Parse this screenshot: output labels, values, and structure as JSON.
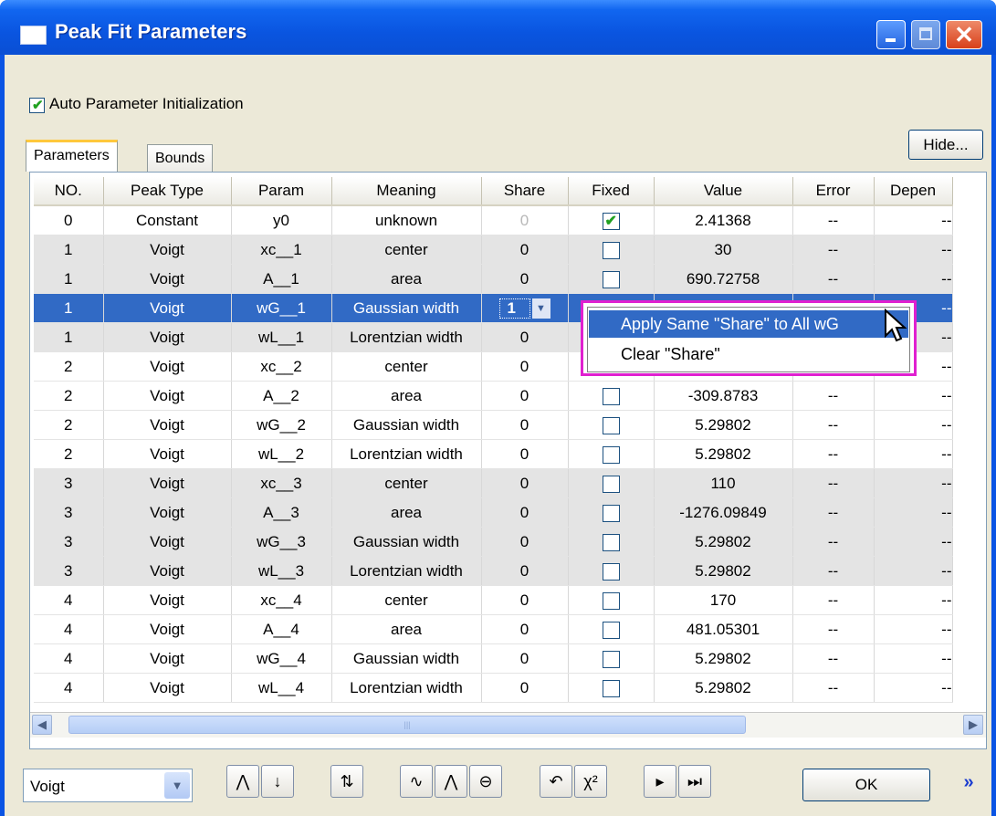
{
  "window": {
    "title": "Peak Fit Parameters",
    "close_glyph": "✕"
  },
  "auto_init": {
    "label": "Auto Parameter Initialization",
    "checked": true
  },
  "tabs": [
    {
      "label": "Parameters",
      "active": true
    },
    {
      "label": "Bounds",
      "active": false
    }
  ],
  "hide_button": "Hide...",
  "columns": [
    "NO.",
    "Peak Type",
    "Param",
    "Meaning",
    "Share",
    "Fixed",
    "Value",
    "Error",
    "Depen"
  ],
  "rows": [
    {
      "no": "0",
      "type": "Constant",
      "param": "y0",
      "meaning": "unknown",
      "share": "0",
      "fixed": true,
      "value": "2.41368",
      "error": "--",
      "dep": "--",
      "style": "w",
      "share_dim": true
    },
    {
      "no": "1",
      "type": "Voigt",
      "param": "xc__1",
      "meaning": "center",
      "share": "0",
      "fixed": false,
      "value": "30",
      "error": "--",
      "dep": "--",
      "style": "g"
    },
    {
      "no": "1",
      "type": "Voigt",
      "param": "A__1",
      "meaning": "area",
      "share": "0",
      "fixed": false,
      "value": "690.72758",
      "error": "--",
      "dep": "--",
      "style": "g"
    },
    {
      "no": "1",
      "type": "Voigt",
      "param": "wG__1",
      "meaning": "Gaussian width",
      "share": "1",
      "fixed": false,
      "value": "",
      "error": "",
      "dep": "--",
      "style": "sel"
    },
    {
      "no": "1",
      "type": "Voigt",
      "param": "wL__1",
      "meaning": "Lorentzian width",
      "share": "0",
      "fixed": false,
      "value": "",
      "error": "",
      "dep": "--",
      "style": "g"
    },
    {
      "no": "2",
      "type": "Voigt",
      "param": "xc__2",
      "meaning": "center",
      "share": "0",
      "fixed": false,
      "value": "",
      "error": "",
      "dep": "--",
      "style": "w"
    },
    {
      "no": "2",
      "type": "Voigt",
      "param": "A__2",
      "meaning": "area",
      "share": "0",
      "fixed": false,
      "value": "-309.8783",
      "error": "--",
      "dep": "--",
      "style": "w"
    },
    {
      "no": "2",
      "type": "Voigt",
      "param": "wG__2",
      "meaning": "Gaussian width",
      "share": "0",
      "fixed": false,
      "value": "5.29802",
      "error": "--",
      "dep": "--",
      "style": "w"
    },
    {
      "no": "2",
      "type": "Voigt",
      "param": "wL__2",
      "meaning": "Lorentzian width",
      "share": "0",
      "fixed": false,
      "value": "5.29802",
      "error": "--",
      "dep": "--",
      "style": "w"
    },
    {
      "no": "3",
      "type": "Voigt",
      "param": "xc__3",
      "meaning": "center",
      "share": "0",
      "fixed": false,
      "value": "110",
      "error": "--",
      "dep": "--",
      "style": "g"
    },
    {
      "no": "3",
      "type": "Voigt",
      "param": "A__3",
      "meaning": "area",
      "share": "0",
      "fixed": false,
      "value": "-1276.09849",
      "error": "--",
      "dep": "--",
      "style": "g"
    },
    {
      "no": "3",
      "type": "Voigt",
      "param": "wG__3",
      "meaning": "Gaussian width",
      "share": "0",
      "fixed": false,
      "value": "5.29802",
      "error": "--",
      "dep": "--",
      "style": "g"
    },
    {
      "no": "3",
      "type": "Voigt",
      "param": "wL__3",
      "meaning": "Lorentzian width",
      "share": "0",
      "fixed": false,
      "value": "5.29802",
      "error": "--",
      "dep": "--",
      "style": "g"
    },
    {
      "no": "4",
      "type": "Voigt",
      "param": "xc__4",
      "meaning": "center",
      "share": "0",
      "fixed": false,
      "value": "170",
      "error": "--",
      "dep": "--",
      "style": "w"
    },
    {
      "no": "4",
      "type": "Voigt",
      "param": "A__4",
      "meaning": "area",
      "share": "0",
      "fixed": false,
      "value": "481.05301",
      "error": "--",
      "dep": "--",
      "style": "w"
    },
    {
      "no": "4",
      "type": "Voigt",
      "param": "wG__4",
      "meaning": "Gaussian width",
      "share": "0",
      "fixed": false,
      "value": "5.29802",
      "error": "--",
      "dep": "--",
      "style": "w"
    },
    {
      "no": "4",
      "type": "Voigt",
      "param": "wL__4",
      "meaning": "Lorentzian width",
      "share": "0",
      "fixed": false,
      "value": "5.29802",
      "error": "--",
      "dep": "--",
      "style": "w"
    }
  ],
  "context_menu": {
    "items": [
      "Apply Same \"Share\" to All wG",
      "Clear \"Share\""
    ]
  },
  "scrollbar": {
    "left_arrow": "◀",
    "right_arrow": "▶",
    "grip": "|||"
  },
  "footer": {
    "peak_type": "Voigt",
    "tools": [
      {
        "icon": "peak-x-icon",
        "glyph": "⋀"
      },
      {
        "icon": "sort-down-icon",
        "glyph": "↓"
      },
      {
        "icon": "peak-arrows-icon",
        "glyph": "⇅"
      },
      {
        "icon": "peak-curve-icon",
        "glyph": "∿"
      },
      {
        "icon": "peak-center-icon",
        "glyph": "⋀"
      },
      {
        "icon": "peak-width-icon",
        "glyph": "⊖"
      },
      {
        "icon": "undo-icon",
        "glyph": "↶"
      },
      {
        "icon": "chi-square-icon",
        "glyph": "χ²"
      },
      {
        "icon": "one-iteration-icon",
        "glyph": "▸"
      },
      {
        "icon": "fit-until-converged-icon",
        "glyph": "⏭"
      }
    ],
    "ok_label": "OK",
    "more_glyph": "»"
  },
  "colors": {
    "selection": "#316ac5",
    "title_bar": "#0a55e0",
    "highlight_frame": "#e020d0"
  }
}
